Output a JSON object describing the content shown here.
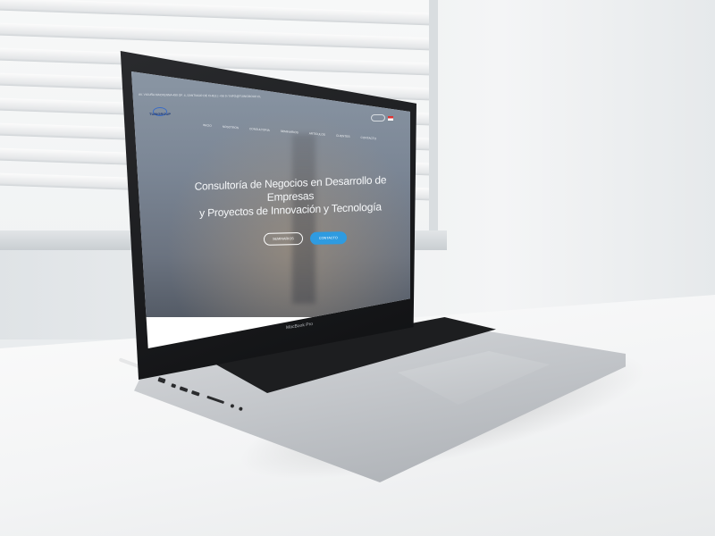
{
  "website": {
    "topbar": "AV. VICUÑA MACKENNA 490 OF. 4, SANTIAGO DE CHILE | +56 9 / INFO@TUINGROUP.CL",
    "logo": "TUINGROUP",
    "nav": [
      "INICIO",
      "NOSOTROS",
      "CONSULTORIA",
      "SEMINARIOS",
      "ARTÍCULOS",
      "CLIENTES",
      "CONTACTO"
    ],
    "headline_line1": "Consultoría de Negocios en Desarrollo de Empresas",
    "headline_line2": "y Proyectos de Innovación y Tecnología",
    "btn_seminarios": "SEMINARIOS",
    "btn_contacto": "CONTACTO"
  },
  "laptop": {
    "label": "MacBook Pro"
  },
  "colors": {
    "cta_blue": "#2f9be0",
    "hero_overlay": "#7b8695",
    "laptop_aluminum": "#c3c6ca",
    "bezel": "#111214"
  },
  "icons": [
    "logo-mark",
    "flag-icon"
  ]
}
